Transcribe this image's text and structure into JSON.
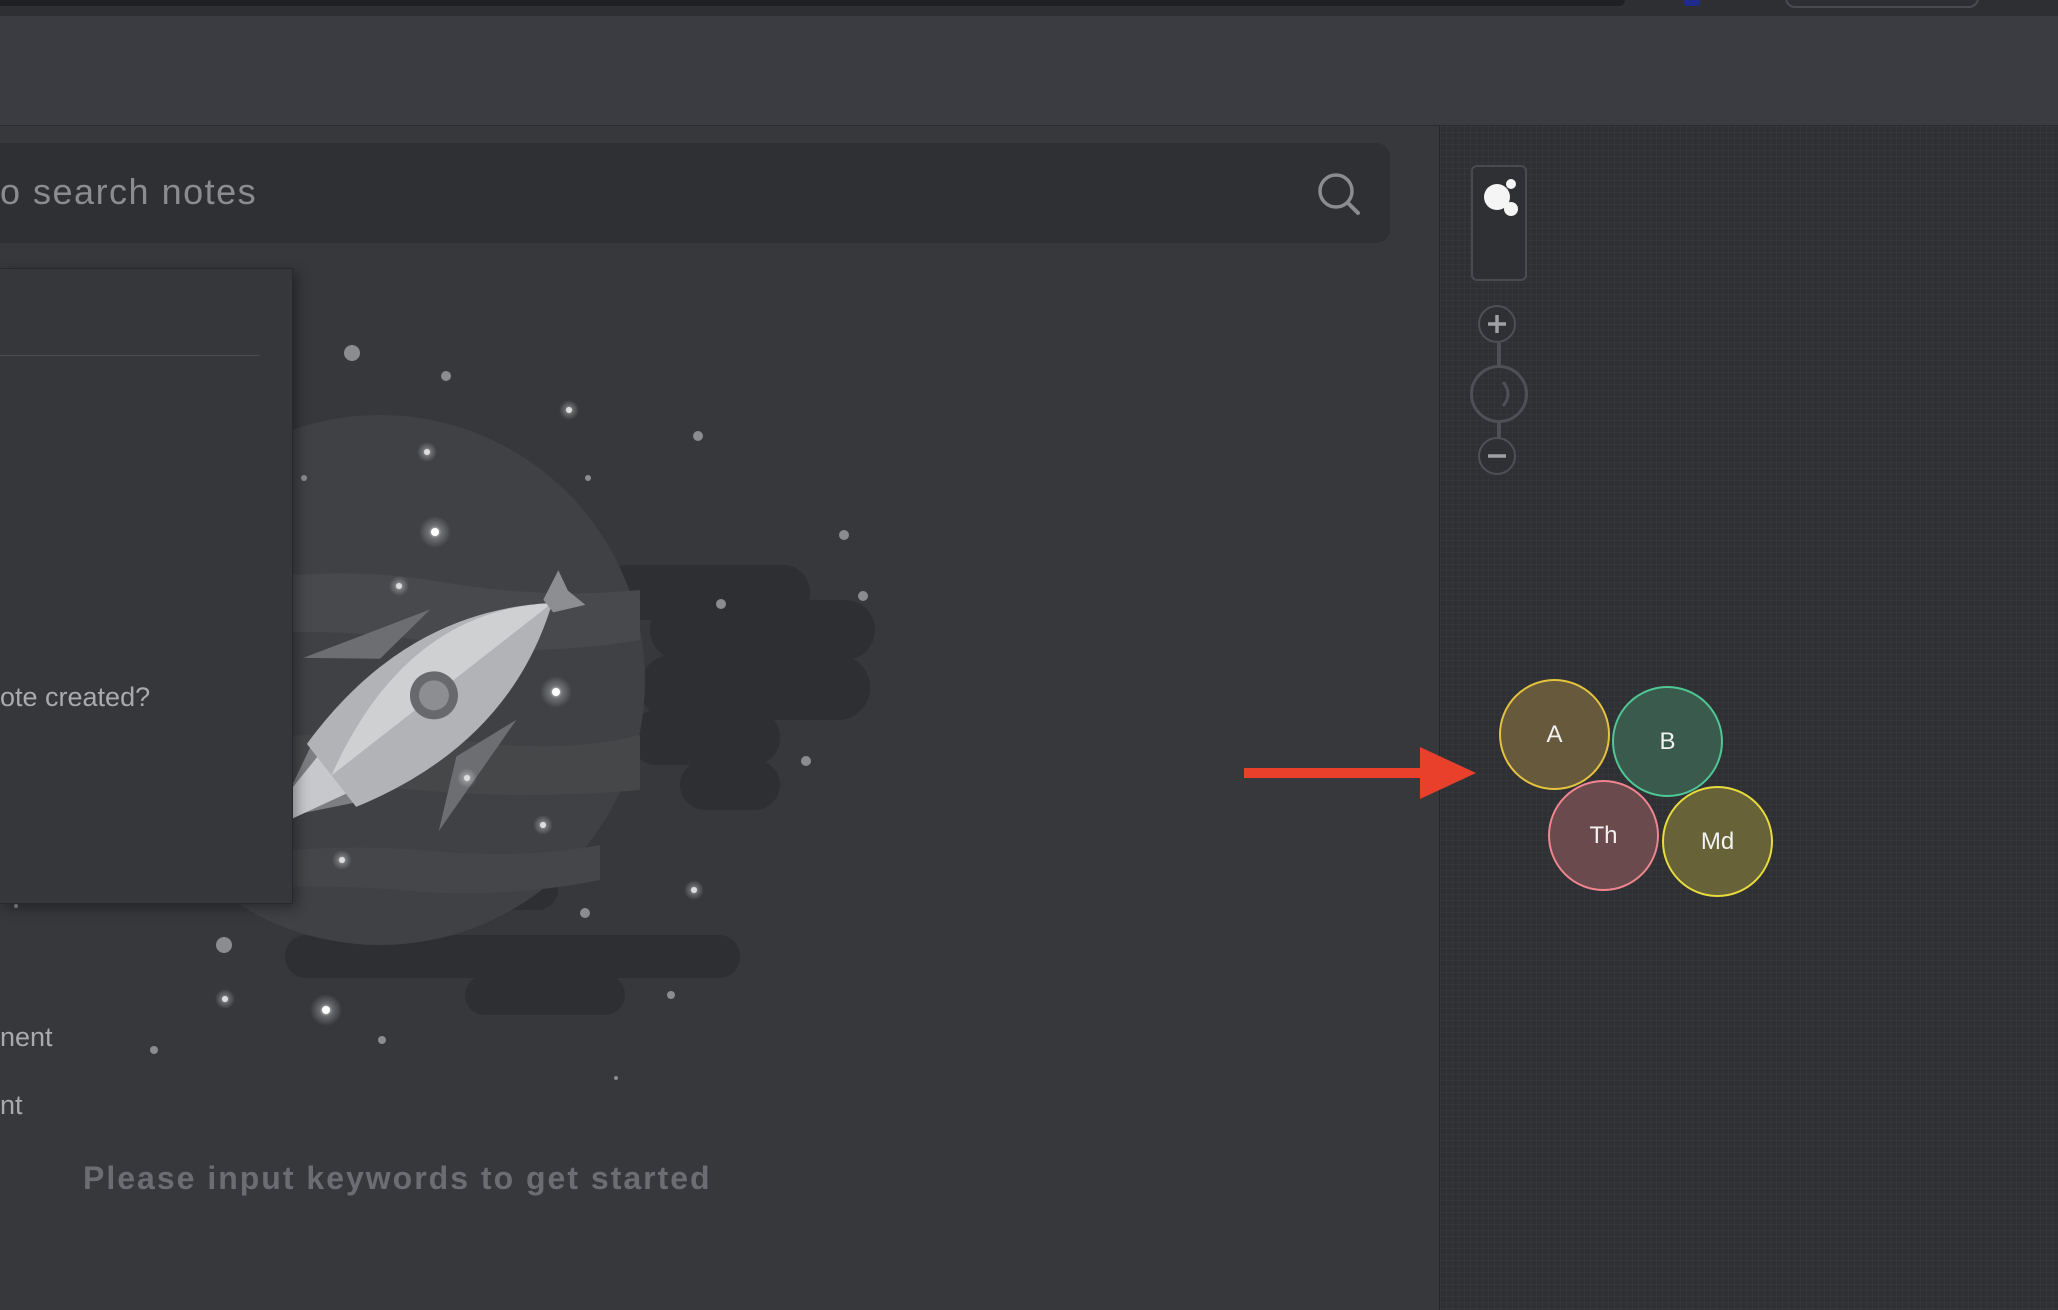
{
  "search": {
    "placeholder": "o search notes"
  },
  "dropdown": {
    "items": [
      "ote created?",
      "nent",
      "nt"
    ]
  },
  "empty_state": {
    "hint": "Please input keywords to get started"
  },
  "graph": {
    "nodes": [
      {
        "label": "A",
        "fill": "#675a3c",
        "stroke": "#e5c33e"
      },
      {
        "label": "B",
        "fill": "#3a5a4e",
        "stroke": "#4fc795"
      },
      {
        "label": "Th",
        "fill": "#6b4a4e",
        "stroke": "#f08590"
      },
      {
        "label": "Md",
        "fill": "#676238",
        "stroke": "#e8dc3c"
      }
    ]
  },
  "colors": {
    "arrow": "#e8402a",
    "background": "#37383c",
    "panel": "#2f3034"
  }
}
